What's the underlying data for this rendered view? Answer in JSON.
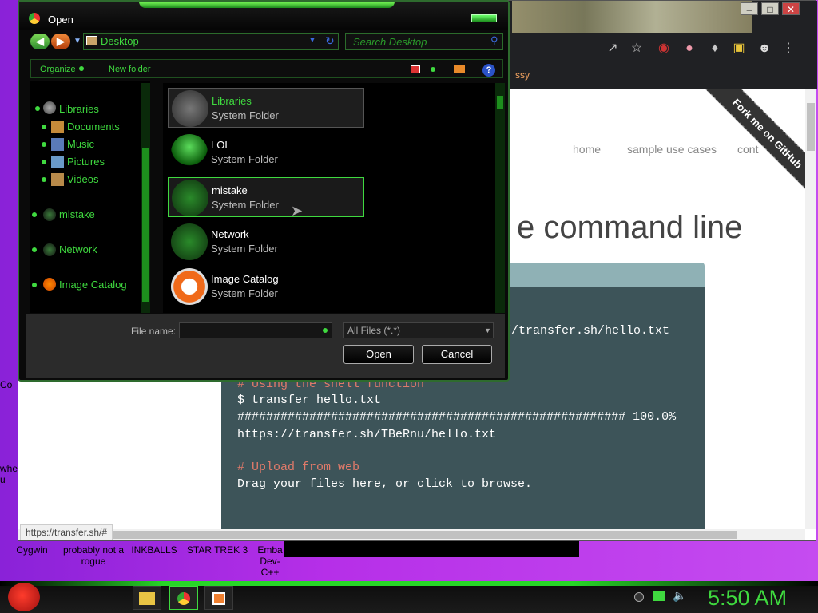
{
  "dialog": {
    "title": "Open",
    "address": "Desktop",
    "search_placeholder": "Search Desktop",
    "toolbar": {
      "organize": "Organize",
      "new_folder": "New folder",
      "help": "?"
    },
    "nav_items": [
      {
        "label": "Libraries",
        "icon": "libraries-icon"
      },
      {
        "label": "Documents",
        "icon": "documents-icon"
      },
      {
        "label": "Music",
        "icon": "music-icon"
      },
      {
        "label": "Pictures",
        "icon": "pictures-icon"
      },
      {
        "label": "Videos",
        "icon": "videos-icon"
      },
      {
        "label": "mistake",
        "icon": "folder-icon"
      },
      {
        "label": "Network",
        "icon": "network-icon"
      },
      {
        "label": "Image Catalog",
        "icon": "image-catalog-icon"
      }
    ],
    "files": [
      {
        "name": "Libraries",
        "type": "System Folder"
      },
      {
        "name": "LOL",
        "type": "System Folder"
      },
      {
        "name": "mistake",
        "type": "System Folder"
      },
      {
        "name": "Network",
        "type": "System Folder"
      },
      {
        "name": "Image Catalog",
        "type": "System Folder"
      }
    ],
    "file_name_label": "File name:",
    "file_name_value": "",
    "filter": "All Files (*.*)",
    "open_label": "Open",
    "cancel_label": "Cancel"
  },
  "page": {
    "bookmark_text": "ssy",
    "nav": {
      "home": "home",
      "sample": "sample use cases",
      "cont": "cont"
    },
    "ribbon": "Fork me on GitHub",
    "headline": "e command line",
    "code": {
      "line1": "://transfer.sh/hello.txt",
      "comment1": "# Using the shell function",
      "line2": "$ transfer hello.txt",
      "line3": "###################################################### 100.0%",
      "line4": "https://transfer.sh/TBeRnu/hello.txt",
      "comment2": "# Upload from web",
      "line5": "Drag your files here, or click to browse."
    },
    "status_url": "https://transfer.sh/#"
  },
  "desktop": {
    "icons": [
      "Cygwin",
      "probably not a rogue",
      "INKBALLS",
      "STAR TREK 3",
      "Emba Dev-C++"
    ],
    "left_labels": [
      "Co",
      "whe u"
    ]
  },
  "taskbar": {
    "clock": "5:50 AM"
  },
  "colors": {
    "accent": "#3fd93f",
    "code_bg": "#3d5459",
    "desktop": "#b62fe8"
  }
}
